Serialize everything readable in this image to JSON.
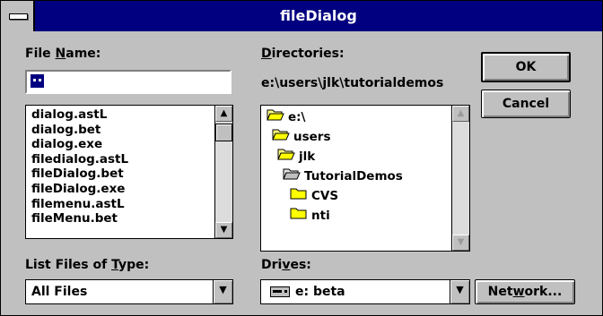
{
  "window": {
    "title": "fileDialog"
  },
  "file_name": {
    "label": "File Name:",
    "value": ""
  },
  "files": [
    "dialog.astL",
    "dialog.bet",
    "dialog.exe",
    "filedialog.astL",
    "fileDialog.bet",
    "fileDialog.exe",
    "filemenu.astL",
    "fileMenu.bet"
  ],
  "directories": {
    "label": "Directories:",
    "current_path": "e:\\users\\jlk\\tutorialdemos",
    "items": [
      {
        "name": "e:\\",
        "state": "open"
      },
      {
        "name": "users",
        "state": "open"
      },
      {
        "name": "jlk",
        "state": "open"
      },
      {
        "name": "TutorialDemos",
        "state": "open-selected"
      },
      {
        "name": "CVS",
        "state": "closed"
      },
      {
        "name": "nti",
        "state": "closed"
      }
    ]
  },
  "file_type": {
    "label": "List Files of Type:",
    "value": "All Files"
  },
  "drives": {
    "label": "Drives:",
    "value": "e: beta",
    "icon": "drive-icon"
  },
  "buttons": {
    "ok": "OK",
    "cancel": "Cancel",
    "network": "Network..."
  },
  "scroll_glyphs": {
    "up": "▲",
    "down": "▼",
    "combo": "▼"
  }
}
